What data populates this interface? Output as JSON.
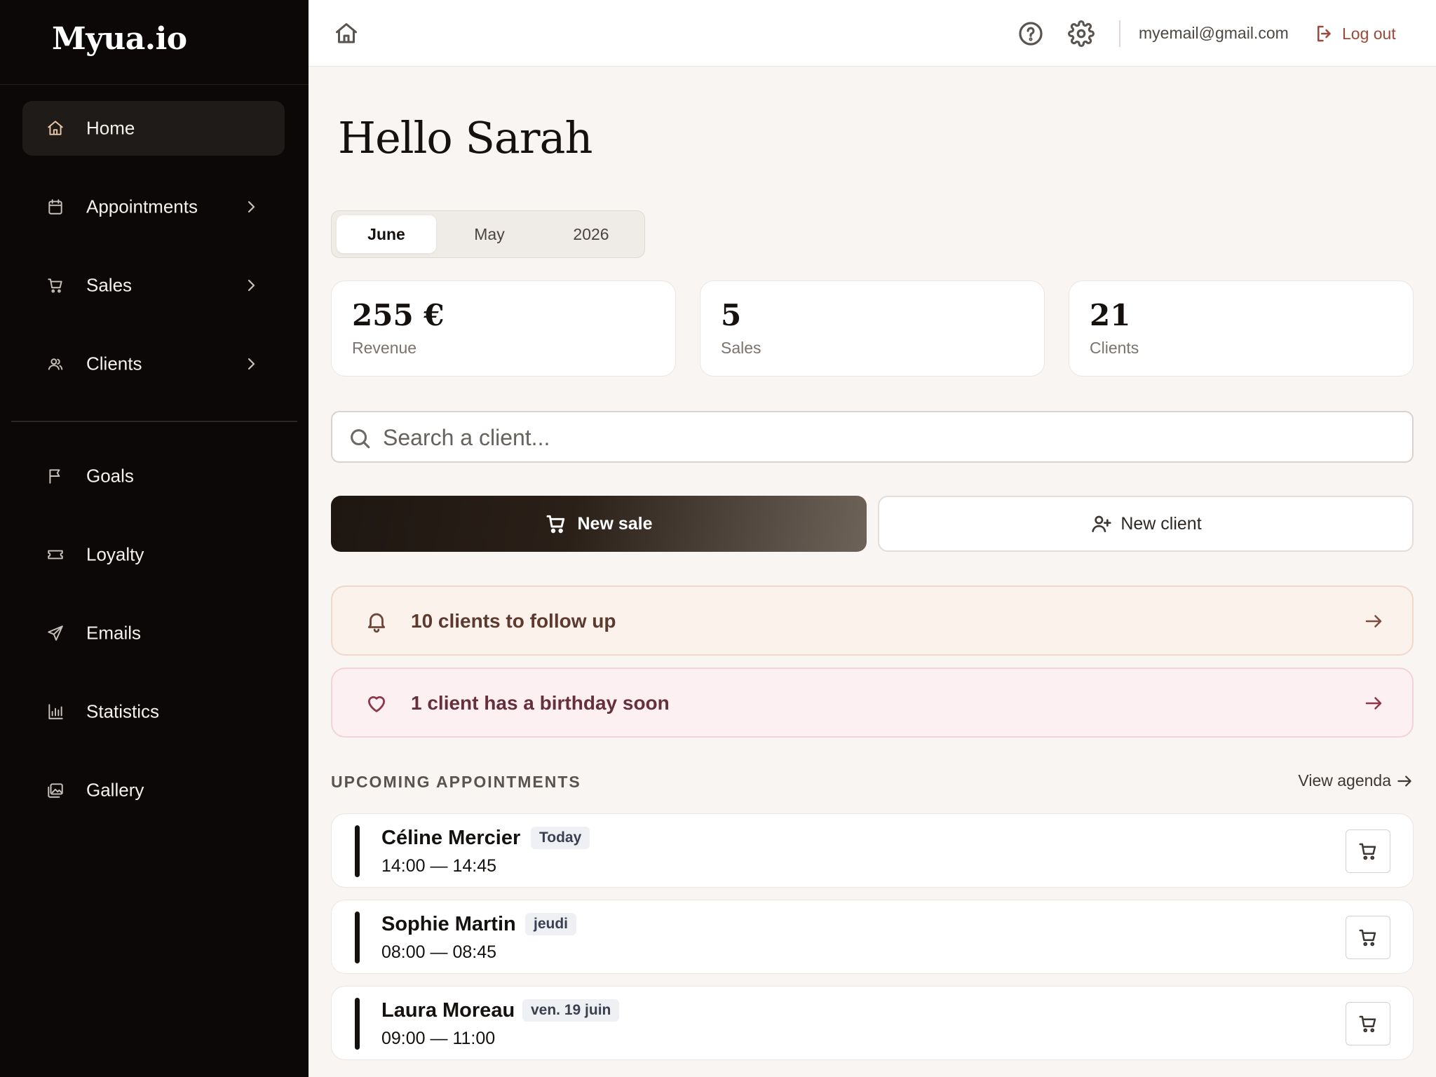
{
  "app": {
    "logo": "Myua.io"
  },
  "sidebar": {
    "items": [
      {
        "label": "Home",
        "icon": "home-icon",
        "active": true,
        "has_submenu": false
      },
      {
        "label": "Appointments",
        "icon": "calendar-icon",
        "active": false,
        "has_submenu": true
      },
      {
        "label": "Sales",
        "icon": "cart-icon",
        "active": false,
        "has_submenu": true
      },
      {
        "label": "Clients",
        "icon": "users-icon",
        "active": false,
        "has_submenu": true
      },
      {
        "label": "Goals",
        "icon": "flag-icon",
        "active": false,
        "has_submenu": false
      },
      {
        "label": "Loyalty",
        "icon": "ticket-icon",
        "active": false,
        "has_submenu": false
      },
      {
        "label": "Emails",
        "icon": "send-icon",
        "active": false,
        "has_submenu": false
      },
      {
        "label": "Statistics",
        "icon": "bar-chart-icon",
        "active": false,
        "has_submenu": false
      },
      {
        "label": "Gallery",
        "icon": "images-icon",
        "active": false,
        "has_submenu": false
      }
    ]
  },
  "topbar": {
    "email": "myemail@gmail.com",
    "logout_label": "Log out",
    "icons": [
      "home-icon",
      "help-icon",
      "settings-icon",
      "logout-icon"
    ]
  },
  "main": {
    "greeting": "Hello Sarah",
    "period_tabs": [
      {
        "label": "June",
        "active": true
      },
      {
        "label": "May",
        "active": false
      },
      {
        "label": "2026",
        "active": false
      }
    ],
    "stats": [
      {
        "value": "255 €",
        "label": "Revenue"
      },
      {
        "value": "5",
        "label": "Sales"
      },
      {
        "value": "21",
        "label": "Clients"
      }
    ],
    "search": {
      "placeholder": "Search a client...",
      "value": ""
    },
    "actions": {
      "new_sale": "New sale",
      "new_client": "New client"
    },
    "alerts": {
      "followup": "10 clients to follow up",
      "birthday": "1 client has a birthday soon"
    },
    "upcoming": {
      "title": "UPCOMING APPOINTMENTS",
      "view_agenda": "View agenda",
      "items": [
        {
          "name": "Céline Mercier",
          "badge": "Today",
          "time": "14:00 — 14:45"
        },
        {
          "name": "Sophie Martin",
          "badge": "jeudi",
          "time": "08:00 — 08:45"
        },
        {
          "name": "Laura Moreau",
          "badge": "ven. 19 juin",
          "time": "09:00 — 11:00"
        }
      ]
    }
  },
  "colors": {
    "sidebar_bg": "#0c0808",
    "page_bg": "#f8f5f2",
    "accent_logout": "#9c4a38",
    "followup_bg": "#fbf2ec",
    "birthday_bg": "#fcf0f3"
  }
}
